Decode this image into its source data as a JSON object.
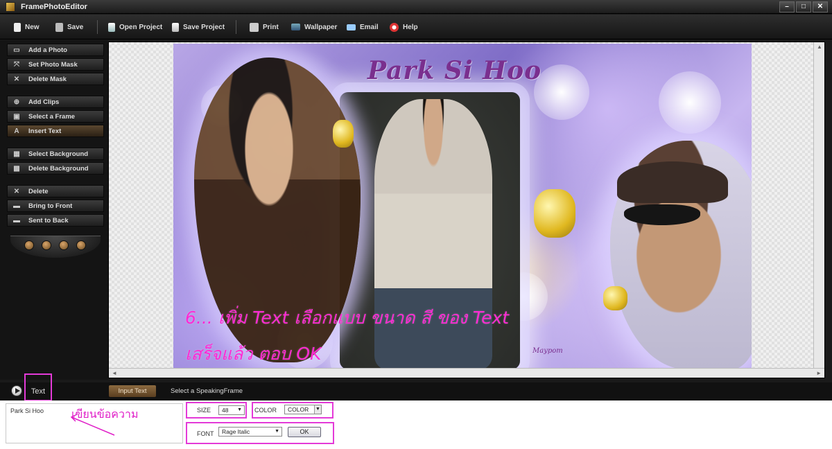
{
  "window": {
    "title": "FramePhotoEditor"
  },
  "toolbar": {
    "new": "New",
    "save": "Save",
    "open_project": "Open Project",
    "save_project": "Save Project",
    "print": "Print",
    "wallpaper": "Wallpaper",
    "email": "Email",
    "help": "Help"
  },
  "sidebar": {
    "items": [
      {
        "label": "Add a Photo",
        "icon": "add-photo-icon",
        "glyph": "▭"
      },
      {
        "label": "Set Photo Mask",
        "icon": "mask-icon",
        "glyph": "⤧"
      },
      {
        "label": "Delete Mask",
        "icon": "delete-mask-icon",
        "glyph": "✕"
      },
      {
        "label": "Add Clips",
        "icon": "clips-icon",
        "glyph": "⊕"
      },
      {
        "label": "Select a Frame",
        "icon": "frame-icon",
        "glyph": "▣"
      },
      {
        "label": "Insert Text",
        "icon": "text-icon",
        "glyph": "A"
      },
      {
        "label": "Select Background",
        "icon": "background-icon",
        "glyph": "▦"
      },
      {
        "label": "Delete Background",
        "icon": "delete-background-icon",
        "glyph": "▩"
      },
      {
        "label": "Delete",
        "icon": "delete-icon",
        "glyph": "✕"
      },
      {
        "label": "Bring to Front",
        "icon": "front-icon",
        "glyph": "▬"
      },
      {
        "label": "Sent to Back",
        "icon": "back-icon",
        "glyph": "▬"
      }
    ]
  },
  "canvas": {
    "photo_title": "Park Si Hoo",
    "signature": "Maypom",
    "instruction_line1": "6... เพิ่ม Text เลือกแบบ ขนาด สี ของ Text",
    "instruction_line2": "เสร็จแล้ว ตอบ OK"
  },
  "bottom": {
    "section_label": "Text",
    "tab_input": "Input Text",
    "tab_speaking": "Select a SpeakingFrame",
    "text_value": "Park Si Hoo",
    "annotation": "เขียนข้อความ",
    "size_label": "SIZE",
    "size_value": "48",
    "color_label": "COLOR",
    "color_value": "COLOR",
    "font_label": "FONT",
    "font_value": "Rage Italic",
    "ok_label": "OK"
  },
  "colors": {
    "highlight": "#e43ad8",
    "instruction": "#ff2ad4",
    "title": "#7a2f8e"
  }
}
